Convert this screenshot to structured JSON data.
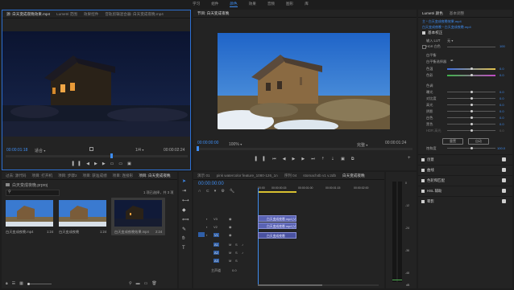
{
  "menu": [
    "学习",
    "组件",
    "颜色",
    "效果",
    "音频",
    "图形",
    "库"
  ],
  "menu_active": 2,
  "source": {
    "tabs": [
      "源: 白天变成夜晚效果.mp4",
      "Lumetri 范围",
      "效果控件",
      "音轨剪辑混合器: 白天变成夜晚.mp4"
    ],
    "timecode": "00:00:01:18",
    "fit": "适合",
    "ratio": "1/4",
    "duration": "00:00:02:24"
  },
  "program": {
    "title": "节目: 白天变成夜晚",
    "timecode": "00:00:00:00",
    "fit": "100%",
    "quality": "完整",
    "duration": "00:00:01:24"
  },
  "project": {
    "tabs": [
      "过去: 源代码",
      "项目: 打开机",
      "项目: 步骤2",
      "项目: 获准成绩",
      "项目: 连接形",
      "项目: 白天变成夜晚"
    ],
    "name": "白天变成夜晚.prproj",
    "count": "1 项已选择，共 3 项",
    "items": [
      {
        "name": "白天变成夜晚.mp4",
        "dur": "1:24"
      },
      {
        "name": "白天变成夜晚",
        "dur": "1:24"
      },
      {
        "name": "白天变成夜晚效果.mp4",
        "dur": "2:24"
      }
    ]
  },
  "timeline": {
    "tabs": [
      "演示 01",
      "pink watercolor feature_1080-126_1n",
      "序列 04",
      "stomach4b v1 v.2db",
      "白天变成夜晚"
    ],
    "timecode": "00:00:00:00",
    "ruler": [
      "00:00",
      "00:00:00:15",
      "00:00:01:00",
      "00:00:01:15",
      "00:00:02:00"
    ],
    "tracks": [
      "V3",
      "V2",
      "V1",
      "A1",
      "A2",
      "A3",
      "主声道"
    ],
    "master_value": "0.0",
    "clips": [
      "白天变成夜晚.mp4 [V]",
      "白天变成夜晚.mp4 [V]",
      "白天变成夜晚"
    ]
  },
  "meter": {
    "labels": [
      "0",
      "-12",
      "-24",
      "-36",
      "-48"
    ],
    "db": "dB"
  },
  "lumetri": {
    "tabs": [
      "Lumetri 颜色",
      "基本调整"
    ],
    "clip": "主 * 白天变成夜晚效果.mp4",
    "subclip": "白天变成夜晚 * 白天变成夜晚.mp4",
    "basic": "基本校正",
    "input_lut": "输入 LUT",
    "input_lut_value": "无",
    "hdr": "HDR 白色",
    "hdr_value": "100",
    "wb_header": "白平衡",
    "wb_picker": "白平衡选择器",
    "temp": {
      "label": "色温",
      "value": "0.0"
    },
    "tint": {
      "label": "色彩",
      "value": "0.0"
    },
    "tone_header": "色调",
    "tone": [
      {
        "label": "曝光",
        "value": "0.0"
      },
      {
        "label": "对比度",
        "value": "0.0"
      },
      {
        "label": "高光",
        "value": "0.0"
      },
      {
        "label": "阴影",
        "value": "0.0"
      },
      {
        "label": "白色",
        "value": "0.0"
      },
      {
        "label": "黑色",
        "value": "0.0"
      },
      {
        "label": "HDR 高光",
        "value": "0.0"
      }
    ],
    "reset": "重置",
    "auto": "自动",
    "saturation": {
      "label": "饱和度",
      "value": "100.0"
    },
    "sections": [
      "创意",
      "曲线",
      "色轮和匹配",
      "HSL 辅助",
      "晕影"
    ]
  }
}
